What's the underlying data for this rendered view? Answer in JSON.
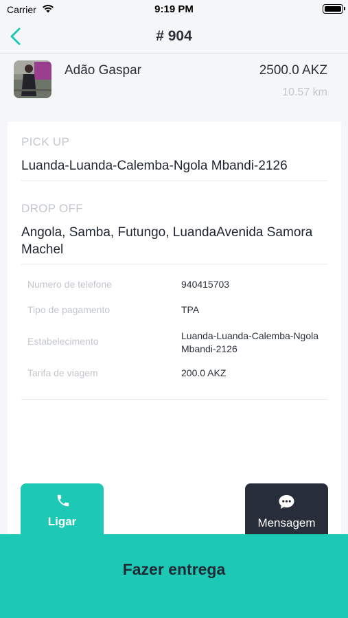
{
  "status_bar": {
    "carrier": "Carrier",
    "time": "9:19 PM"
  },
  "nav": {
    "title": "# 904",
    "back_icon": "chevron-left-icon"
  },
  "customer": {
    "name": "Adão Gaspar",
    "price": "2500.0 AKZ",
    "distance": "10.57 km"
  },
  "pickup": {
    "label": "PICK UP",
    "address": "Luanda-Luanda-Calemba-Ngola Mbandi-2126"
  },
  "dropoff": {
    "label": "DROP OFF",
    "address": "Angola, Samba, Futungo, LuandaAvenida Samora Machel"
  },
  "details": [
    {
      "label": "Numero de telefone",
      "value": "940415703"
    },
    {
      "label": "Tipo de pagamento",
      "value": "TPA"
    },
    {
      "label": "Estabelecimento",
      "value": "Luanda-Luanda-Calemba-Ngola Mbandi-2126"
    },
    {
      "label": "Tarifa de viagem",
      "value": "200.0 AKZ"
    }
  ],
  "actions": {
    "call_label": "Ligar",
    "call_icon": "phone-icon",
    "message_label": "Mensagem",
    "message_icon": "chat-bubble-icon",
    "deliver_label": "Fazer entrega"
  },
  "colors": {
    "accent": "#1dc9b5",
    "dark_button": "#282d3a",
    "background": "#f5f6f8"
  }
}
